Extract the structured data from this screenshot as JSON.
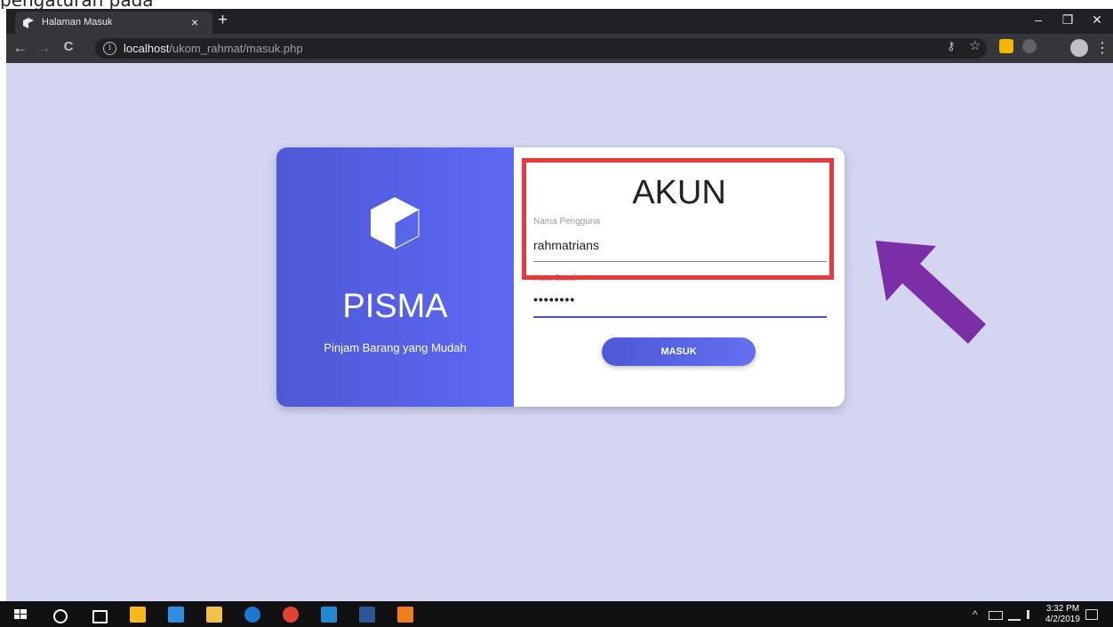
{
  "caption": {
    "text": "pengaturan pada"
  },
  "browser": {
    "tab_title": "Halaman Masuk",
    "tab_close": "×",
    "new_tab": "+",
    "url_host": "localhost",
    "url_path": "/ukom_rahmat/masuk.php",
    "win_min": "–",
    "win_max": "❐",
    "win_close": "✕",
    "back": "←",
    "forward": "→",
    "reload": "C",
    "info": "i",
    "key": "⚷",
    "star": "☆",
    "menu": "⋮"
  },
  "brand": {
    "name": "PISMA",
    "tagline": "Pinjam Barang yang Mudah"
  },
  "login": {
    "title": "AKUN",
    "username_label": "Nama Pengguna",
    "username_value": "rahmatrians",
    "password_label": "Kata Sandi",
    "password_value": "••••••••",
    "submit_label": "MASUK"
  },
  "annotation": {
    "highlight_color": "#e8383d",
    "arrow_color": "#7b2fa6"
  },
  "taskbar": {
    "time": "3:32 PM",
    "date": "4/2/2019"
  }
}
